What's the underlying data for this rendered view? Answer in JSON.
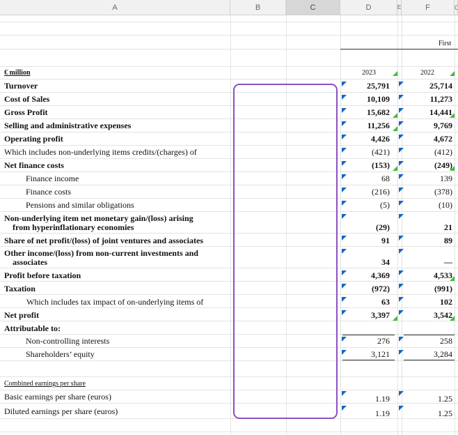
{
  "columns": [
    "A",
    "B",
    "C",
    "D",
    "E",
    "F",
    "G"
  ],
  "header_first": "First",
  "sheet": {
    "unit_label": "€ million",
    "year_d": "2023",
    "year_f": "2022",
    "rows": [
      {
        "label": "Turnover",
        "d": "25,791",
        "f": "25,714"
      },
      {
        "label": "Cost of Sales",
        "d": "10,109",
        "f": "11,273"
      },
      {
        "label": "Gross Profit",
        "d": "15,682",
        "f": "14,441"
      },
      {
        "label": "Selling and administrative expenses",
        "d": "11,256",
        "f": "9,769"
      },
      {
        "label": "Operating profit",
        "d": "4,426",
        "f": "4,672"
      },
      {
        "label": "Which includes non-underlying items credits/(charges) of",
        "d": "(421)",
        "f": "(412)"
      },
      {
        "label": "Net finance costs",
        "d": "(153)",
        "f": "(249)"
      },
      {
        "label": "Finance income",
        "d": "68",
        "f": "139"
      },
      {
        "label": "Finance costs",
        "d": "(216)",
        "f": "(378)"
      },
      {
        "label": "Pensions and similar obligations",
        "d": "(5)",
        "f": "(10)"
      },
      {
        "label": "Non-underlying item net monetary gain/(loss) arising",
        "label2": "from hyperinflationary economies",
        "d": "(29)",
        "f": "21"
      },
      {
        "label": "Share of net profit/(loss) of joint ventures and associates",
        "d": "91",
        "f": "89"
      },
      {
        "label": "Other income/(loss) from non-current investments and",
        "label2": "associates",
        "d": "34",
        "f": "—"
      },
      {
        "label": "Profit before taxation",
        "d": "4,369",
        "f": "4,533"
      },
      {
        "label": "Taxation",
        "d": "(972)",
        "f": "(991)"
      },
      {
        "label": "Which includes tax impact of on-underlying items of",
        "d": "63",
        "f": "102"
      },
      {
        "label": "Net profit",
        "d": "3,397",
        "f": "3,542"
      },
      {
        "label": "Attributable to:",
        "d": "",
        "f": ""
      },
      {
        "label": "Non-controlling interests",
        "d": "276",
        "f": "258"
      },
      {
        "label": "Shareholders’ equity",
        "d": "3,121",
        "f": "3,284"
      }
    ],
    "eps_heading": "Combined earnings per share",
    "eps_rows": [
      {
        "label": "Basic earnings per share (euros)",
        "d": "1.19",
        "f": "1.25"
      },
      {
        "label": "Diluted earnings per share (euros)",
        "d": "1.19",
        "f": "1.25"
      }
    ]
  },
  "colors": {
    "selection": "#8e4fbf",
    "marker_blue": "#1565c0",
    "marker_green": "#3cbf3c",
    "header_bg": "#f1f1f1"
  }
}
